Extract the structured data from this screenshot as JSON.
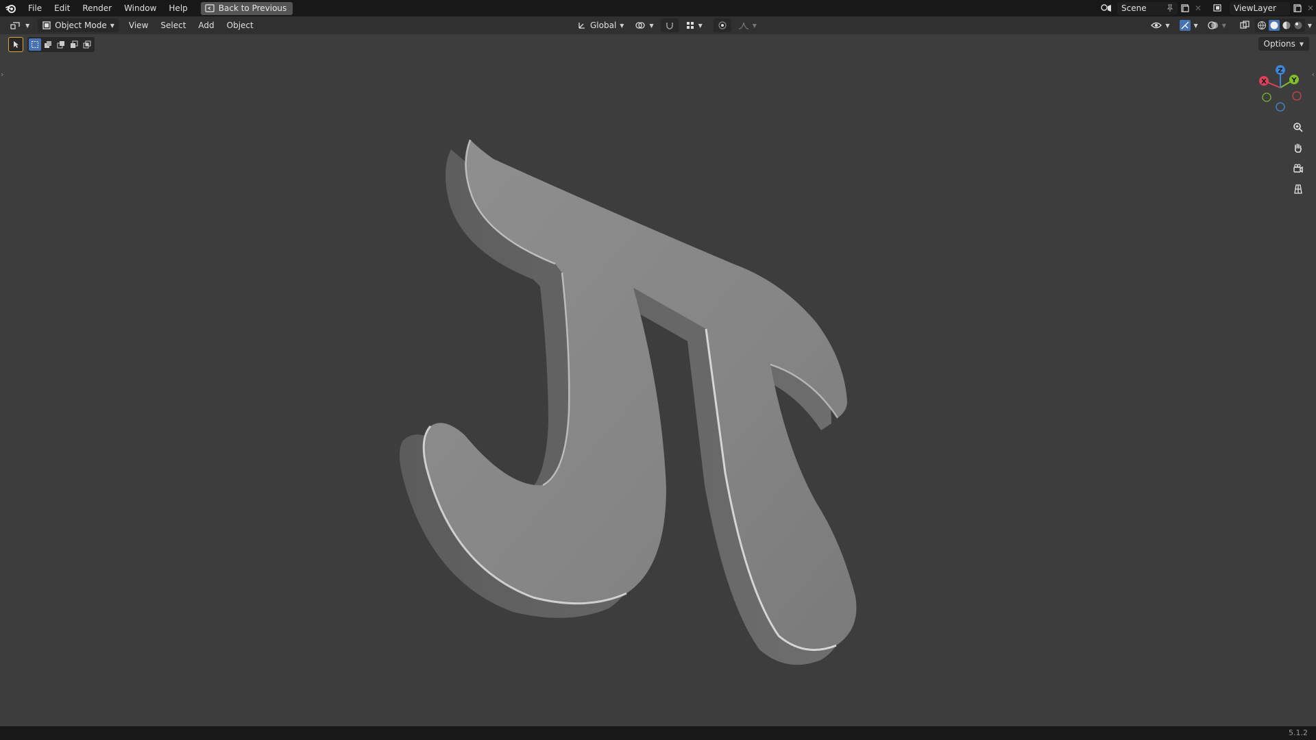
{
  "topbar": {
    "menus": [
      "File",
      "Edit",
      "Render",
      "Window",
      "Help"
    ],
    "back_button": "Back to Previous",
    "scene_name": "Scene",
    "view_layer_name": "ViewLayer"
  },
  "header": {
    "mode": "Object Mode",
    "menus": [
      "View",
      "Select",
      "Add",
      "Object"
    ],
    "transform_orientation": "Global"
  },
  "viewport": {
    "options_label": "Options",
    "gizmo_axes": [
      "X",
      "Y",
      "Z"
    ],
    "object": "pi-symbol"
  },
  "status": {
    "version": "5.1.2"
  },
  "colors": {
    "accent": "#4772b3",
    "axis_x": "#e0405a",
    "axis_y": "#7fbf2a",
    "axis_z": "#3e86d6",
    "active_tool": "#e3a13b"
  },
  "icons": [
    "blender-logo-icon",
    "back-icon",
    "editor-type-icon",
    "mode-icon",
    "transform-icon",
    "pivot-icon",
    "snap-icon",
    "proportional-icon",
    "zoom-icon",
    "hand-icon",
    "camera-icon",
    "grid-icon",
    "shading-icons",
    "overlay-icon",
    "xray-icon",
    "pin-icon",
    "new-scene-icon",
    "close-icon"
  ]
}
